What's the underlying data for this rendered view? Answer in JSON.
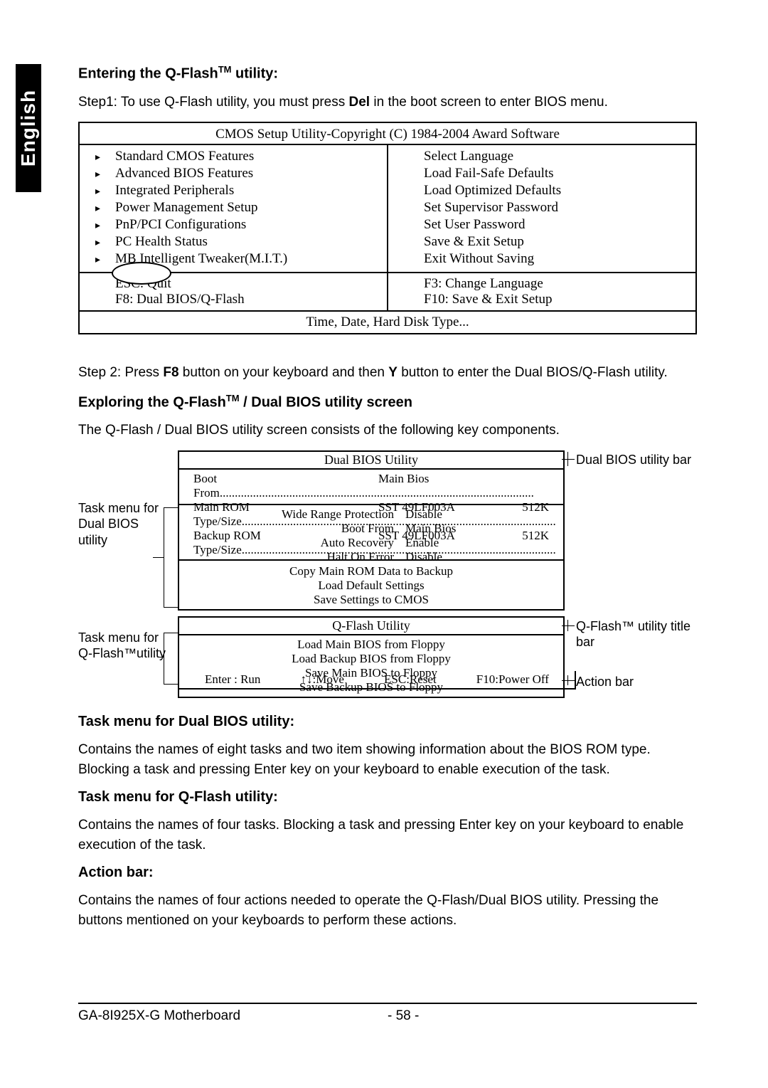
{
  "lang_tab": "English",
  "sec1_heading_pre": "Entering the Q-Flash",
  "sec1_heading_post": " utility:",
  "step1_pre": "Step1: To use Q-Flash utility, you must press ",
  "step1_key": "Del",
  "step1_post": " in the boot screen to enter BIOS menu.",
  "bios": {
    "title": "CMOS Setup Utility-Copyright (C) 1984-2004 Award Software",
    "left": [
      "Standard CMOS Features",
      "Advanced BIOS Features",
      "Integrated Peripherals",
      "Power Management Setup",
      "PnP/PCI Configurations",
      "PC Health Status",
      "MB Intelligent Tweaker(M.I.T.)"
    ],
    "right": [
      "Select Language",
      "Load Fail-Safe Defaults",
      "Load Optimized Defaults",
      "Set Supervisor Password",
      "Set User Password",
      "Save & Exit Setup",
      "Exit Without Saving"
    ],
    "foot_left": [
      "ESC: Quit",
      "F8: Dual BIOS/Q-Flash"
    ],
    "foot_right": [
      "F3: Change Language",
      "F10: Save & Exit Setup"
    ],
    "status": "Time, Date, Hard Disk Type..."
  },
  "step2_pre": "Step 2: Press ",
  "step2_key1": "F8",
  "step2_mid": " button on your keyboard and then ",
  "step2_key2": "Y",
  "step2_post": " button to enter the Dual BIOS/Q-Flash utility.",
  "sec2_heading_pre": "Exploring the Q-Flash",
  "sec2_heading_post": " / Dual BIOS utility screen",
  "sec2_body": "The Q-Flash / Dual BIOS utility screen consists of the following key components.",
  "diagram": {
    "info_title": "Dual BIOS Utility",
    "info_rows": [
      {
        "l": "Boot From",
        "m": "Main Bios",
        "r": ""
      },
      {
        "l": "Main ROM Type/Size",
        "m": "SST 49LF003A",
        "r": "512K"
      },
      {
        "l": "Backup ROM Type/Size",
        "m": "SST 49LF003A",
        "r": "512K"
      }
    ],
    "tasks1": [
      {
        "k": "Wide Range Protection",
        "v": "Disable"
      },
      {
        "k": "Boot From",
        "v": "Main Bios"
      },
      {
        "k": "Auto Recovery",
        "v": "Enable"
      },
      {
        "k": "Halt On Error",
        "v": "Disable"
      }
    ],
    "tasks1_single": [
      "Copy Main ROM Data to Backup",
      "Load Default Settings",
      "Save Settings to CMOS"
    ],
    "tasks2_title": "Q-Flash Utility",
    "tasks2": [
      "Load Main BIOS from Floppy",
      "Load Backup BIOS from Floppy",
      "Save Main BIOS to Floppy",
      "Save Backup BIOS to Floppy"
    ],
    "actions": [
      "Enter : Run",
      "↑↓:Move",
      "ESC:Reset",
      "F10:Power Off"
    ],
    "label_l1": "Task menu for Dual BIOS utility",
    "label_l2": "Task menu for Q-Flash™utility",
    "label_r1": "Dual BIOS utility bar",
    "label_r2": "Q-Flash™ utility title bar",
    "label_r3": "Action bar"
  },
  "sec3_h": "Task menu for Dual BIOS utility:",
  "sec3_b": "Contains the names of eight tasks and two item showing information about the BIOS ROM type. Blocking a task and pressing Enter key on your keyboard to enable execution of the task.",
  "sec4_h": "Task menu for Q-Flash utility:",
  "sec4_b": "Contains the names of four tasks. Blocking a task and pressing Enter key on your keyboard to enable execution of the task.",
  "sec5_h": "Action bar:",
  "sec5_b": "Contains the names of four actions needed to operate the Q-Flash/Dual BIOS utility. Pressing the buttons mentioned on your keyboards to perform these actions.",
  "footer_left": "GA-8I925X-G Motherboard",
  "footer_page": "- 58 -"
}
